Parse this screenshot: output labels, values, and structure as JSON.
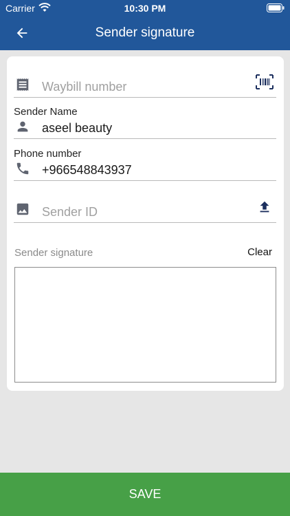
{
  "status": {
    "carrier": "Carrier",
    "time": "10:30 PM"
  },
  "header": {
    "title": "Sender signature",
    "back_icon": "arrow-back-icon"
  },
  "form": {
    "waybill": {
      "placeholder": "Waybill number",
      "icon": "receipt-icon",
      "action_icon": "barcode-scan-icon"
    },
    "sender_name": {
      "label": "Sender Name",
      "value": "aseel beauty",
      "icon": "person-icon"
    },
    "phone": {
      "label": "Phone number",
      "value": "+966548843937",
      "icon": "phone-icon"
    },
    "sender_id": {
      "placeholder": "Sender ID",
      "icon": "image-icon",
      "action_icon": "upload-icon"
    },
    "signature": {
      "label": "Sender signature",
      "clear_label": "Clear"
    }
  },
  "footer": {
    "save_label": "SAVE"
  },
  "colors": {
    "header": "#21579a",
    "save": "#47a047",
    "icon": "#5f6470",
    "accent_icon": "#1c2f5e"
  }
}
